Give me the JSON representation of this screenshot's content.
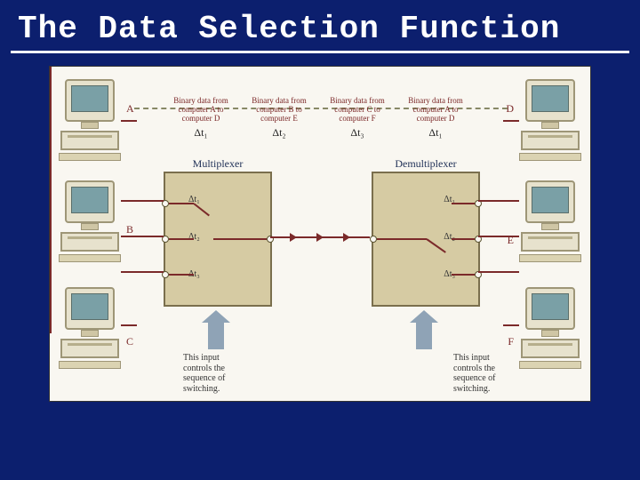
{
  "title": "The Data Selection Function",
  "computers": {
    "A": "A",
    "B": "B",
    "C": "C",
    "D": "D",
    "E": "E",
    "F": "F"
  },
  "boxes": {
    "mux": "Multiplexer",
    "demux": "Demultiplexer"
  },
  "deltas": {
    "dt1": "Δt₁",
    "dt2": "Δt₂",
    "dt3": "Δt₃"
  },
  "top_annotations": [
    {
      "text": "Binary data from computer A to computer D",
      "dt": "Δt₁"
    },
    {
      "text": "Binary data from computer B to computer E",
      "dt": "Δt₂"
    },
    {
      "text": "Binary data from computer C to computer F",
      "dt": "Δt₃"
    },
    {
      "text": "Binary data from computer A to computer D",
      "dt": "Δt₁"
    }
  ],
  "bottom_caption": "This input controls the sequence of switching."
}
